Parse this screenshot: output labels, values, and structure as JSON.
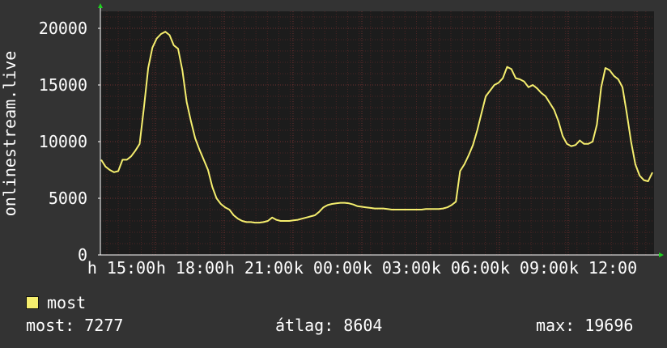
{
  "chart_data": {
    "type": "line",
    "ylabel": "onlinestream.live",
    "ylim": [
      0,
      21500
    ],
    "y_ticks": [
      0,
      5000,
      10000,
      15000,
      20000
    ],
    "y_tick_labels": [
      "0",
      "5000",
      "10000",
      "15000",
      "20000"
    ],
    "x_tick_labels": [
      "h 15:00",
      "h 18:00",
      "h 21:00",
      "k 00:00",
      "k 03:00",
      "k 06:00",
      "k 09:00",
      "k 12:00"
    ],
    "grid": true,
    "series": [
      {
        "name": "most",
        "color": "#f5ee6e",
        "values": [
          8400,
          7800,
          7500,
          7300,
          7400,
          8400,
          8400,
          8700,
          9200,
          9800,
          13000,
          16500,
          18300,
          19100,
          19500,
          19700,
          19400,
          18500,
          18200,
          16300,
          13500,
          11800,
          10300,
          9300,
          8400,
          7500,
          6000,
          5000,
          4500,
          4200,
          4000,
          3500,
          3200,
          3000,
          2900,
          2900,
          2850,
          2850,
          2900,
          3000,
          3300,
          3100,
          3000,
          3000,
          3000,
          3050,
          3100,
          3200,
          3300,
          3400,
          3500,
          3800,
          4200,
          4400,
          4500,
          4550,
          4600,
          4600,
          4550,
          4450,
          4300,
          4250,
          4200,
          4150,
          4100,
          4100,
          4100,
          4050,
          4000,
          4000,
          4000,
          4000,
          4000,
          4000,
          4000,
          4000,
          4050,
          4050,
          4050,
          4050,
          4100,
          4200,
          4400,
          4700,
          7400,
          8000,
          8800,
          9700,
          11000,
          12500,
          14000,
          14500,
          15000,
          15200,
          15600,
          16600,
          16400,
          15600,
          15500,
          15300,
          14800,
          15000,
          14700,
          14300,
          14000,
          13400,
          12800,
          11800,
          10500,
          9800,
          9600,
          9700,
          10100,
          9800,
          9800,
          10000,
          11500,
          14800,
          16500,
          16300,
          15800,
          15500,
          14800,
          12500,
          10000,
          8000,
          7000,
          6600,
          6500,
          7277
        ]
      }
    ]
  },
  "legend": {
    "label": "most"
  },
  "stats": {
    "current": "most: 7277",
    "average": "átlag: 8604",
    "max": "max: 19696"
  },
  "colors": {
    "background": "#333333",
    "plot_background": "#1c1c1c",
    "grid_minor": "#4a2424",
    "grid_major": "#6e3030",
    "line": "#f5ee6e",
    "axis": "#ffffff"
  }
}
